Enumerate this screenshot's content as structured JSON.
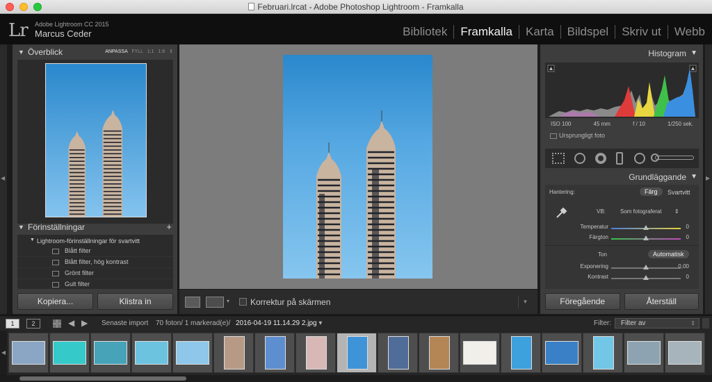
{
  "window": {
    "title": "Februari.lrcat - Adobe Photoshop Lightroom - Framkalla"
  },
  "identity": {
    "logo": "Lr",
    "app_version": "Adobe Lightroom CC 2015",
    "user": "Marcus Ceder",
    "modules": [
      "Bibliotek",
      "Framkalla",
      "Karta",
      "Bildspel",
      "Skriv ut",
      "Webb"
    ],
    "active_module": "Framkalla"
  },
  "left": {
    "navigator": {
      "title": "Överblick",
      "zoom": [
        "ANPASSA",
        "FYLL",
        "1:1",
        "1:8"
      ],
      "active_zoom": "ANPASSA"
    },
    "presets": {
      "title": "Förinställningar",
      "add": "+",
      "folder": "Lightroom-förinställningar för svartvitt",
      "items": [
        "Blått filter",
        "Blått filter, hög kontrast",
        "Grönt filter",
        "Gult filter"
      ]
    },
    "buttons": {
      "copy": "Kopiera...",
      "paste": "Klistra in"
    }
  },
  "toolbar": {
    "proof_label": "Korrektur på skärmen"
  },
  "right": {
    "histogram": {
      "title": "Histogram",
      "iso": "ISO 100",
      "focal": "45 mm",
      "aperture": "f / 10",
      "shutter": "1/250 sek.",
      "original": "Ursprungligt foto"
    },
    "basic": {
      "title": "Grundläggande",
      "treatment_label": "Hantering:",
      "treatment_color": "Färg",
      "treatment_bw": "Svartvitt",
      "wb_label": "VB:",
      "wb_value": "Som fotograferat",
      "temperature": {
        "label": "Temperatur",
        "value": "0",
        "level": 0.5
      },
      "tint": {
        "label": "Färgton",
        "value": "0",
        "level": 0.5
      },
      "tone_label": "Ton",
      "auto": "Automatisk",
      "exposure": {
        "label": "Exponering",
        "value": "0,00",
        "level": 0.5
      },
      "contrast": {
        "label": "Kontrast",
        "value": "0",
        "level": 0.5
      }
    },
    "buttons": {
      "previous": "Föregående",
      "reset": "Återställ"
    }
  },
  "filmstrip": {
    "pages": [
      "1",
      "2"
    ],
    "source": "Senaste import",
    "count": "70 foton/ 1 markerad(e)/",
    "filename": "2016-04-19 11.14.29 2.jpg",
    "filter_label": "Filter:",
    "filter_value": "Filter av",
    "selected_index": 8,
    "thumbs": [
      {
        "color": "#8aa6c4",
        "portrait": false
      },
      {
        "color": "#35c9c9",
        "portrait": false
      },
      {
        "color": "#47a3b8",
        "portrait": false
      },
      {
        "color": "#6cc3e0",
        "portrait": false
      },
      {
        "color": "#8ec7ea",
        "portrait": false
      },
      {
        "color": "#b79a86",
        "portrait": true
      },
      {
        "color": "#5d8fd0",
        "portrait": true
      },
      {
        "color": "#d7b8b6",
        "portrait": true
      },
      {
        "color": "#3f94d8",
        "portrait": true
      },
      {
        "color": "#506c99",
        "portrait": true
      },
      {
        "color": "#b48555",
        "portrait": true
      },
      {
        "color": "#f1efe9",
        "portrait": false
      },
      {
        "color": "#3da1de",
        "portrait": true
      },
      {
        "color": "#3a80c6",
        "portrait": false
      },
      {
        "color": "#72c6e6",
        "portrait": true
      },
      {
        "color": "#8da3b1",
        "portrait": false
      },
      {
        "color": "#a7b4bc",
        "portrait": false
      }
    ]
  }
}
